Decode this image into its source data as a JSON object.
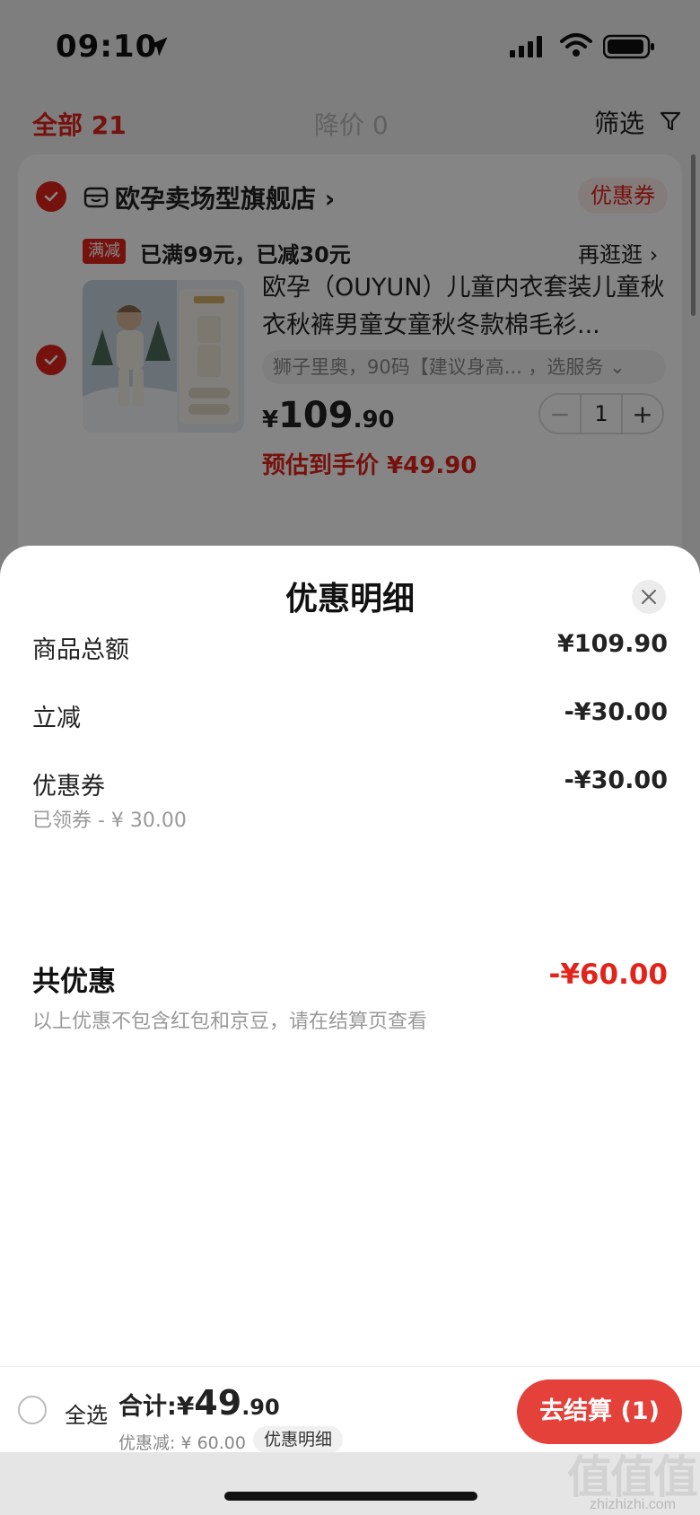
{
  "status_bar": {
    "time": "09:10"
  },
  "filter_bar": {
    "all_label": "全部 21",
    "drop_label": "降价 0",
    "filter_label": "筛选"
  },
  "store": {
    "name": "欧孕卖场型旗舰店 ›",
    "coupon_label": "优惠券",
    "promo_tag": "满减",
    "promo_text": "已满99元，已减30元",
    "promo_more": "再逛逛 ›"
  },
  "product": {
    "title": "欧孕（OUYUN）儿童内衣套装儿童秋衣秋裤男童女童秋冬款棉毛衫...",
    "sku": "狮子里奥，90码【建议身高... ，选服务 ⌄",
    "price_currency": "¥",
    "price_int": "109",
    "price_dec": ".90",
    "quantity": "1",
    "minus": "−",
    "plus": "+",
    "est_price": "预估到手价 ¥49.90"
  },
  "sheet": {
    "title": "优惠明细",
    "rows": [
      {
        "label": "商品总额",
        "value": "¥109.90"
      },
      {
        "label": "立减",
        "value": "-¥30.00"
      },
      {
        "label": "优惠券",
        "value": "-¥30.00",
        "sub": "已领券 - ¥ 30.00"
      }
    ],
    "total_label": "共优惠",
    "total_value": "-¥60.00",
    "total_note": "以上优惠不包含红包和京豆，请在结算页查看"
  },
  "bottom_bar": {
    "select_all": "全选",
    "sum_prefix": "合计:",
    "sum_currency": "¥",
    "sum_int": "49",
    "sum_dec": ".90",
    "discount": "优惠减: ¥ 60.00",
    "detail_label": "优惠明细",
    "checkout_label": "去结算 (1)"
  },
  "watermark": {
    "glyphs": [
      "值",
      "值",
      "值"
    ],
    "url": "zhizhizhi.com"
  },
  "colors": {
    "accent": "#e2231a",
    "checkout": "#e4413a"
  },
  "icons": [
    "location-arrow-icon",
    "signal-icon",
    "wifi-icon",
    "battery-icon",
    "filter-icon",
    "store-icon",
    "check-icon",
    "close-icon"
  ]
}
